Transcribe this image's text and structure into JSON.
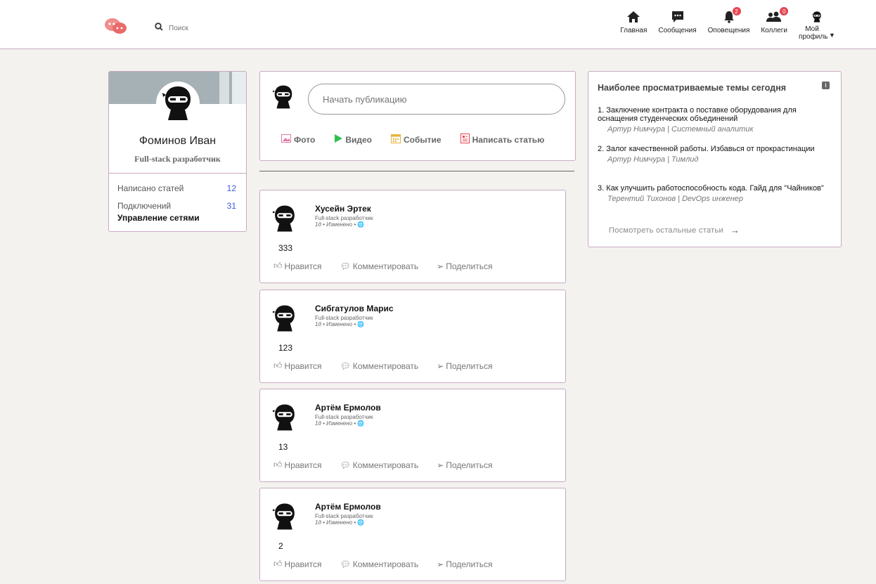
{
  "header": {
    "search_placeholder": "Поиск",
    "nav": [
      {
        "label": "Главная",
        "icon": "home-icon"
      },
      {
        "label": "Сообщения",
        "icon": "messages-icon"
      },
      {
        "label": "Оповещения",
        "icon": "bell-icon",
        "badge": "2"
      },
      {
        "label": "Коллеги",
        "icon": "people-icon",
        "badge": "0"
      },
      {
        "label": "Мой профиль",
        "icon": "avatar-icon"
      }
    ]
  },
  "profile": {
    "name": "Фоминов Иван",
    "role": "Full-stack разработчик",
    "stats": [
      {
        "label": "Написано статей",
        "value": "12"
      },
      {
        "label": "Подключений",
        "value": "31"
      }
    ],
    "manage_label": "Управление сетями"
  },
  "composer": {
    "placeholder": "Начать публикацию",
    "actions": [
      {
        "label": "Фото",
        "icon": "photo-icon",
        "color": "#e27ba6"
      },
      {
        "label": "Видео",
        "icon": "play-icon",
        "color": "#2fbf4f"
      },
      {
        "label": "Событие",
        "icon": "calendar-icon",
        "color": "#e8b33b"
      },
      {
        "label": "Написать статью",
        "icon": "article-icon",
        "color": "#e64553"
      }
    ]
  },
  "posts": [
    {
      "author": "Хусейн Эртек",
      "role": "Full-stack разработчик",
      "meta": "1д • Изменено •",
      "text": "333"
    },
    {
      "author": "Сибгатулов Марис",
      "role": "Full-stack разработчик",
      "meta": "1д • Изменено •",
      "text": "123"
    },
    {
      "author": "Артём Ермолов",
      "role": "Full-stack разработчик",
      "meta": "1д • Изменено •",
      "text": "13"
    },
    {
      "author": "Артём Ермолов",
      "role": "Full-stack разработчик",
      "meta": "1д • Изменено •",
      "text": "2"
    }
  ],
  "post_actions": {
    "like": "Нравится",
    "comment": "Комментировать",
    "share": "Поделиться"
  },
  "trending": {
    "title": "Наиболее просматриваемые темы сегодня",
    "items": [
      {
        "title": "1. Заключение контракта о поставке оборудования для оснащения студенческих объединений",
        "meta": "Артур Нимчура | Системный аналитик"
      },
      {
        "title": "2. Залог качественной работы. Избавься от прокрастинации",
        "meta": "Артур Нимчура | Тимлид"
      },
      {
        "title": "3. Как улучшить работоспособность кода. Гайд для \"Чайников\"",
        "meta": "Терентий Тихонов | DevOps инженер"
      }
    ],
    "see_more": "Посмотреть остальные статьи"
  },
  "colors": {
    "border": "#c9a9c2",
    "badge": "#e64553",
    "accent_link": "#3b5bdb"
  }
}
